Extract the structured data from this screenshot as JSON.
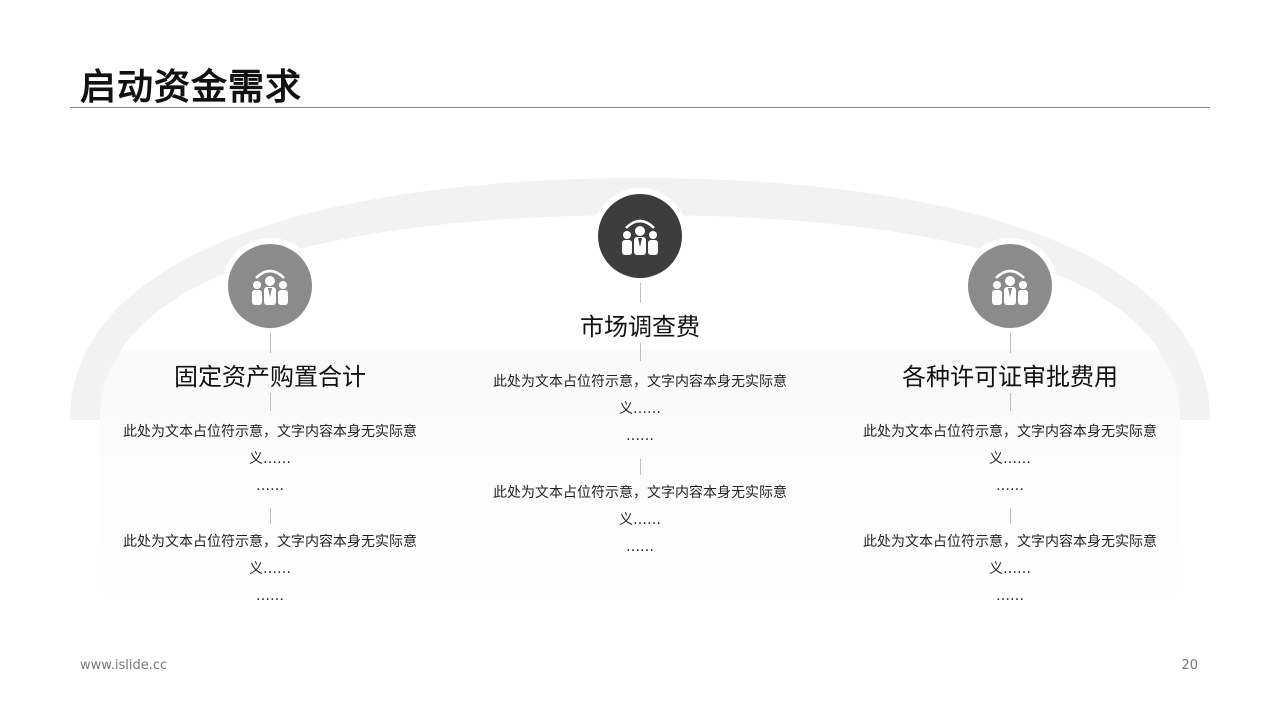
{
  "slide": {
    "title": "启动资金需求",
    "footer_url": "www.islide.cc",
    "page_number": "20"
  },
  "items": [
    {
      "heading": "固定资产购置合计",
      "icon": "team-icon",
      "blocks": [
        {
          "text": "此处为文本占位符示意，文字内容本身无实际意义……",
          "ellipsis": "……"
        },
        {
          "text": "此处为文本占位符示意，文字内容本身无实际意义……",
          "ellipsis": "……"
        }
      ]
    },
    {
      "heading": "市场调查费",
      "icon": "team-icon",
      "blocks": [
        {
          "text": "此处为文本占位符示意，文字内容本身无实际意义……",
          "ellipsis": "……"
        },
        {
          "text": "此处为文本占位符示意，文字内容本身无实际意义……",
          "ellipsis": "……"
        }
      ]
    },
    {
      "heading": "各种许可证审批费用",
      "icon": "team-icon",
      "blocks": [
        {
          "text": "此处为文本占位符示意，文字内容本身无实际意义……",
          "ellipsis": "……"
        },
        {
          "text": "此处为文本占位符示意，文字内容本身无实际意义……",
          "ellipsis": "……"
        }
      ]
    }
  ],
  "colors": {
    "icon_side": "#8b8b8b",
    "icon_center": "#3d3d3d",
    "rule": "#8a8a8a"
  }
}
